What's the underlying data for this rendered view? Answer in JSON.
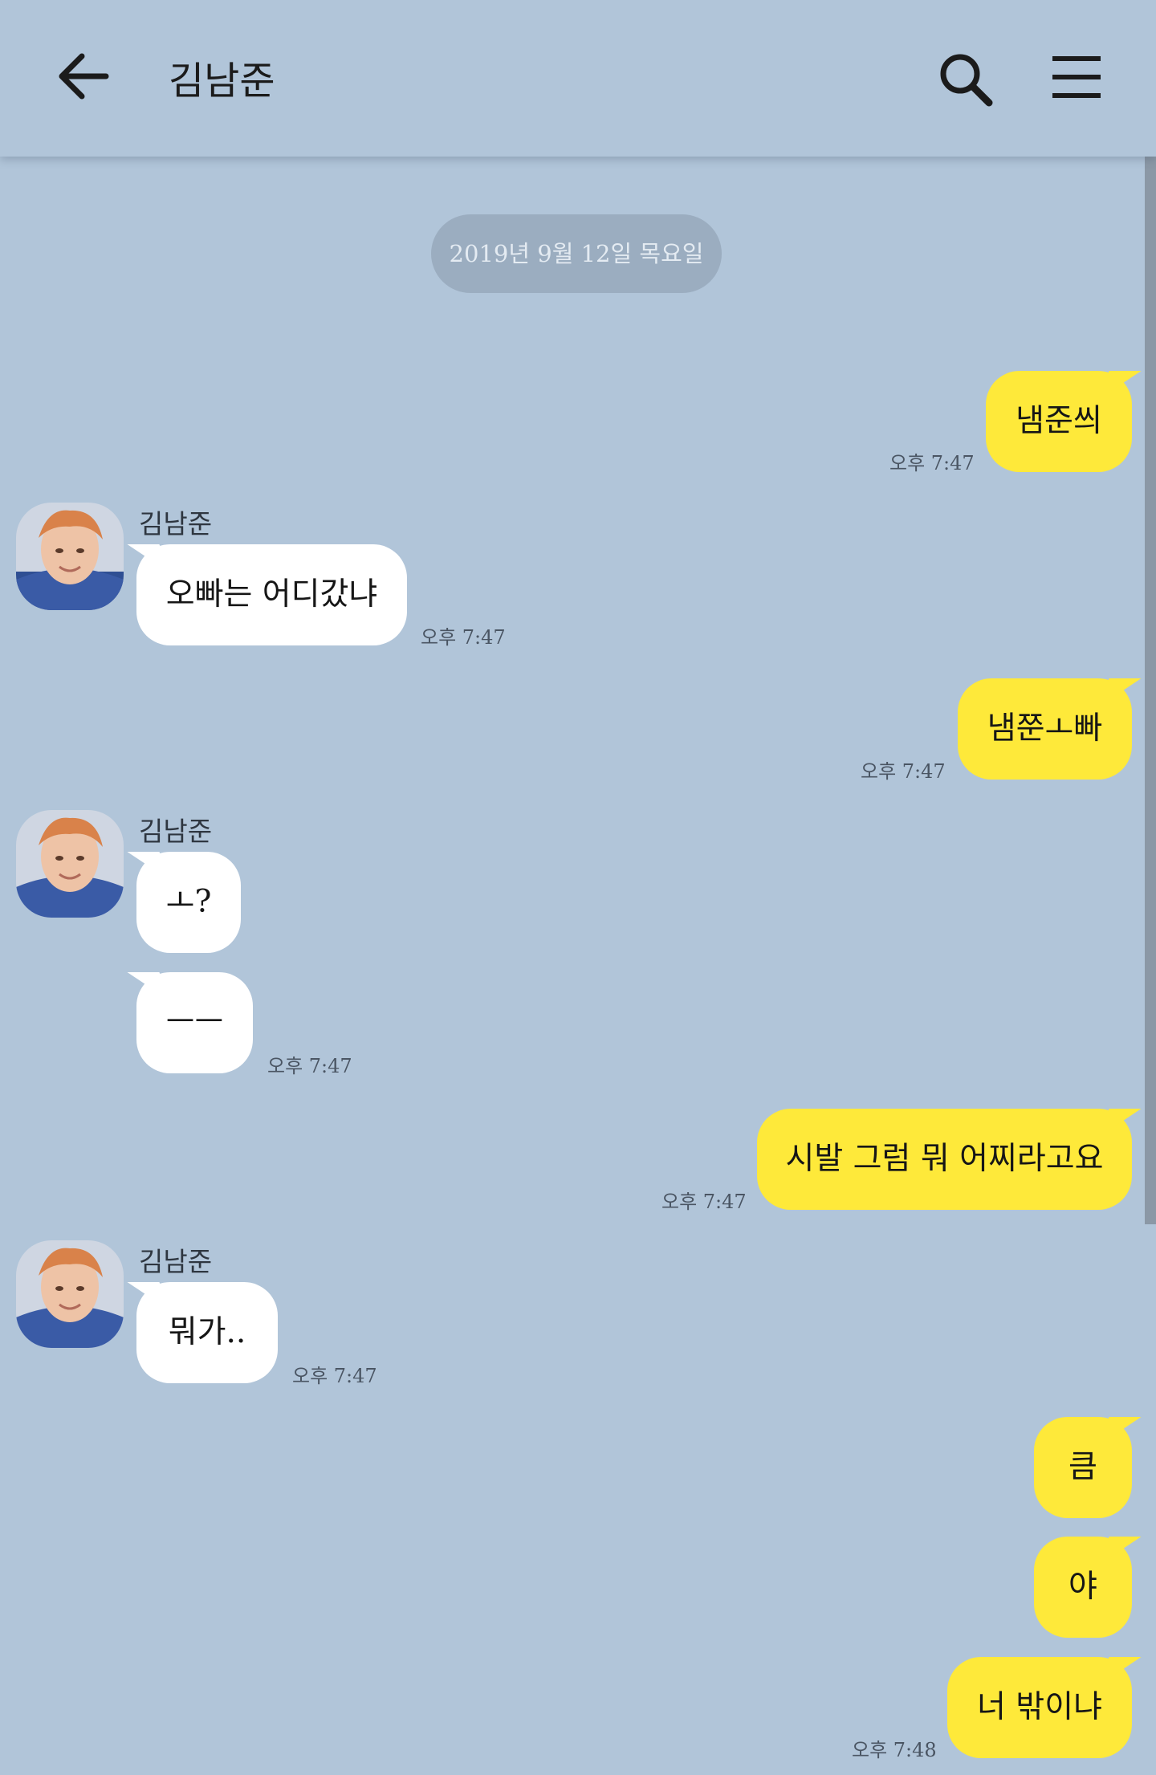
{
  "header": {
    "title": "김남준"
  },
  "date_separator": "2019년 9월 12일 목요일",
  "messages": [
    {
      "sender": "me",
      "text": "냄준씌",
      "time": "오후 7:47"
    },
    {
      "sender": "김남준",
      "text": "오빠는 어디갔냐",
      "time": "오후 7:47"
    },
    {
      "sender": "me",
      "text": "냄쭌ㅗ빠",
      "time": "오후 7:47"
    },
    {
      "sender": "김남준",
      "text": "ㅗ?"
    },
    {
      "sender": "김남준",
      "text": "ㅡㅡ",
      "time": "오후 7:47"
    },
    {
      "sender": "me",
      "text": "시발 그럼 뭐 어찌라고요",
      "time": "오후 7:47"
    },
    {
      "sender": "김남준",
      "text": "뭐가..",
      "time": "오후 7:47"
    },
    {
      "sender": "me",
      "text": "큼"
    },
    {
      "sender": "me",
      "text": "야"
    },
    {
      "sender": "me",
      "text": "너 밖이냐",
      "time": "오후 7:48"
    }
  ],
  "colors": {
    "background": "#b1c5d9",
    "my_bubble": "#fee93a",
    "their_bubble": "#ffffff",
    "date_pill": "#9badc0"
  },
  "icons": [
    "back-arrow-icon",
    "search-icon",
    "menu-icon"
  ]
}
